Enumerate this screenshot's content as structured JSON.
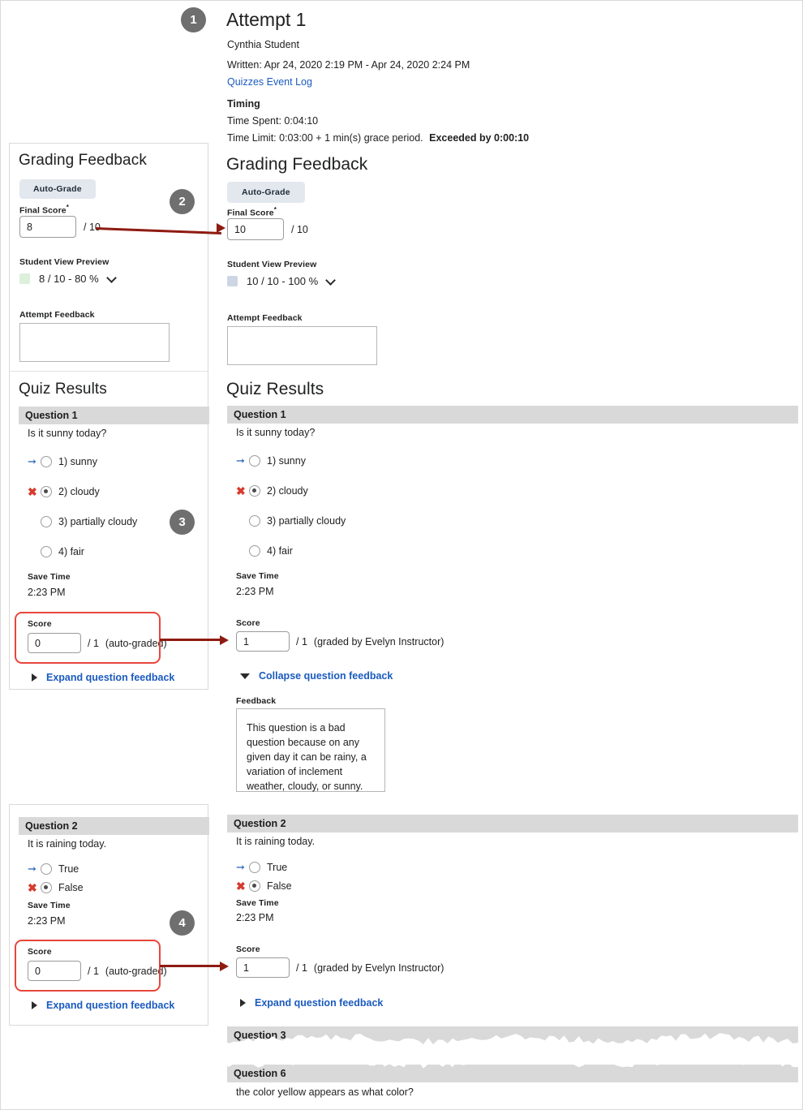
{
  "attempt": {
    "badge": "1",
    "title": "Attempt 1",
    "student": "Cynthia Student",
    "written": "Written: Apr 24, 2020 2:19 PM - Apr 24, 2020 2:24 PM",
    "event_log_link": "Quizzes Event Log",
    "timing_heading": "Timing",
    "time_spent": "Time Spent: 0:04:10",
    "time_limit_prefix": "Time Limit: 0:03:00 + 1 min(s) grace period.",
    "exceeded": "Exceeded by 0:00:10"
  },
  "grading_feedback": {
    "heading": "Grading Feedback",
    "auto_grade_button": "Auto-Grade",
    "final_score_label": "Final Score",
    "required_mark": "*",
    "out_of": "/ 10",
    "student_view_label": "Student View Preview",
    "attempt_feedback_label": "Attempt Feedback",
    "attempt_feedback_value": "",
    "attempt_feedback_placeholder": "",
    "before": {
      "final_score_value": "8",
      "preview_text": "8 / 10 - 80 %",
      "swatch_color": "#dcf0dc"
    },
    "after": {
      "final_score_value": "10",
      "preview_text": "10 / 10 - 100 %",
      "swatch_color": "#ccd6e4"
    }
  },
  "quiz_results": {
    "heading": "Quiz Results",
    "save_time_label": "Save Time",
    "score_label": "Score",
    "out_of_one": "/ 1",
    "auto_graded_note": "(auto-graded)",
    "graded_by_note": "(graded by  Evelyn Instructor)",
    "expand_link": "Expand question feedback",
    "collapse_link": "Collapse question feedback",
    "feedback_label": "Feedback",
    "questions": [
      {
        "badge": "3",
        "header": "Question 1",
        "prompt": "Is it sunny today?",
        "save_time": "2:23 PM",
        "options": [
          {
            "indicator": "arrow",
            "selected": false,
            "label": "1) sunny"
          },
          {
            "indicator": "x",
            "selected": true,
            "label": "2) cloudy"
          },
          {
            "indicator": "none",
            "selected": false,
            "label": "3) partially cloudy"
          },
          {
            "indicator": "none",
            "selected": false,
            "label": "4) fair"
          }
        ],
        "before_score": "0",
        "after_score": "1",
        "feedback_text": "This question is a bad question because on any given day it can be rainy, a variation of inclement weather, cloudy, or sunny."
      },
      {
        "badge": "4",
        "header": "Question 2",
        "prompt": "It is raining today.",
        "save_time": "2:23 PM",
        "options": [
          {
            "indicator": "arrow",
            "selected": false,
            "label": "True"
          },
          {
            "indicator": "x",
            "selected": true,
            "label": "False"
          }
        ],
        "before_score": "0",
        "after_score": "1",
        "feedback_text": ""
      }
    ],
    "truncated": [
      {
        "header": "Question 3",
        "prompt": ""
      },
      {
        "header": "Question 6",
        "prompt": "the color yellow appears as what color?"
      }
    ]
  },
  "colors": {
    "badge_gray": "#6f6f6f",
    "annotation_red": "#8e1b11",
    "highlight_red": "#e8463c",
    "link_blue": "#1b5bbf",
    "qheader_gray": "#d9d9d9",
    "indicator_arrow_blue": "#3b6fc4",
    "indicator_x_red": "#d63b2f"
  }
}
